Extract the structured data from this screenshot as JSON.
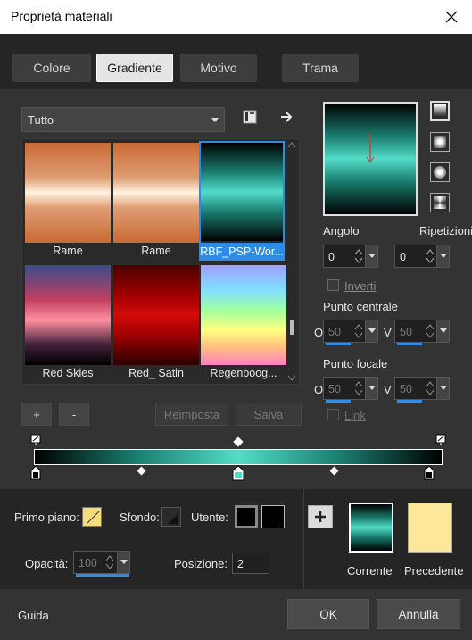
{
  "window": {
    "title": "Proprietà materiali"
  },
  "tabs": [
    {
      "label": "Colore",
      "active": false
    },
    {
      "label": "Gradiente",
      "active": true
    },
    {
      "label": "Motivo",
      "active": false
    },
    {
      "label": "Trama",
      "active": false
    }
  ],
  "category": {
    "selected": "Tutto"
  },
  "gradients": [
    {
      "label": "Rame",
      "selected": false
    },
    {
      "label": "Rame",
      "selected": false
    },
    {
      "label": "RBF_PSP-Wor...",
      "selected": true
    },
    {
      "label": "Red Skies",
      "selected": false
    },
    {
      "label": "Red_ Satin",
      "selected": false
    },
    {
      "label": "Regenboog...",
      "selected": false
    }
  ],
  "list_buttons": {
    "add": "+",
    "remove": "-",
    "reset": "Reimposta",
    "save": "Salva"
  },
  "settings": {
    "angle_label": "Angolo",
    "angle_value": "0",
    "repeats_label": "Ripetizioni",
    "repeats_value": "0",
    "invert_label": "Inverti",
    "invert_checked": false,
    "center_label": "Punto centrale",
    "center_h_label": "O",
    "center_h": "50",
    "center_v_label": "V",
    "center_v": "50",
    "focal_label": "Punto focale",
    "focal_h_label": "O",
    "focal_h": "50",
    "focal_v_label": "V",
    "focal_v": "50",
    "link_label": "Link",
    "link_checked": false
  },
  "gradient_colors": {
    "stops": [
      "#000000",
      "#52dcc8",
      "#000000"
    ],
    "selected_stop_color": "#52dcc8"
  },
  "lower": {
    "foreground_label": "Primo piano:",
    "background_label": "Sfondo:",
    "user_label": "Utente:",
    "opacity_label": "Opacità:",
    "opacity_value": "100",
    "position_label": "Posizione:",
    "position_value": "2",
    "current_label": "Corrente",
    "previous_label": "Precedente",
    "previous_color": "#fce79a"
  },
  "footer": {
    "help": "Guida",
    "ok": "OK",
    "cancel": "Annulla"
  },
  "icons": {
    "close": "close-icon",
    "save_preset": "save-preset-icon",
    "import": "arrow-right-icon",
    "add_material": "plus-icon"
  },
  "colors": {
    "accent": "#2e8ce6",
    "teal": "#52dcc8",
    "dark_teal": "#1a7e70"
  }
}
